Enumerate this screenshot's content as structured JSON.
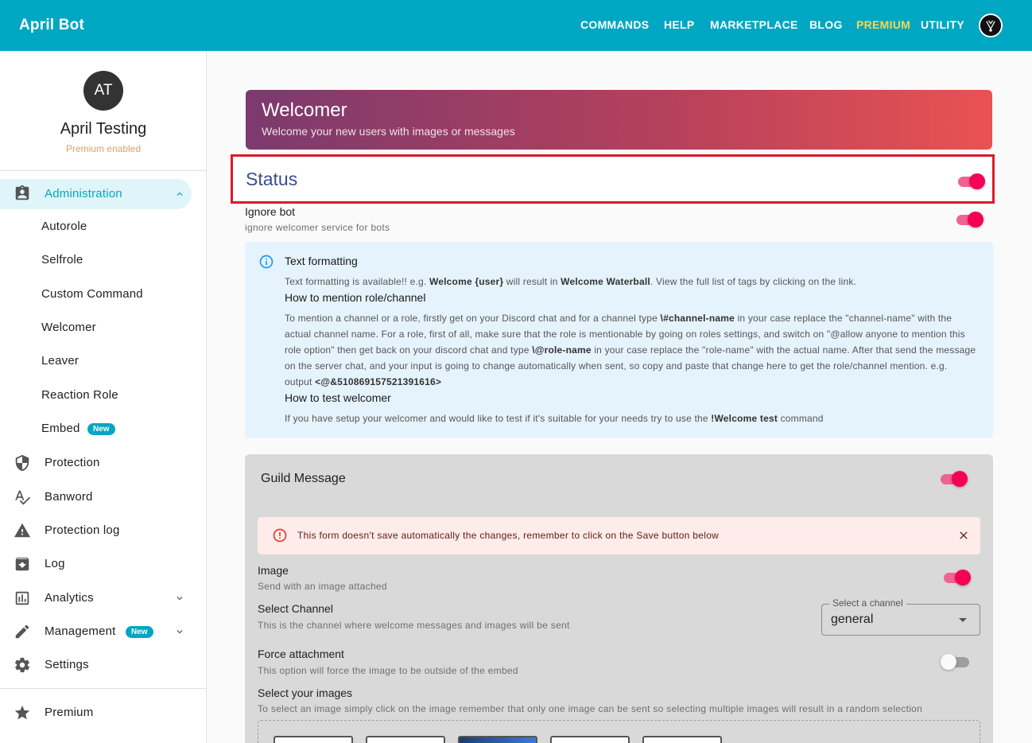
{
  "app": {
    "brand": "April Bot"
  },
  "topnav": {
    "items": [
      "COMMANDS",
      "HELP",
      "MARKETPLACE",
      "BLOG",
      "PREMIUM",
      "UTILITY"
    ]
  },
  "user": {
    "initials": "AT",
    "name": "April Testing",
    "subtitle": "Premium enabled"
  },
  "sidebar": {
    "administration": "Administration",
    "sub_items": [
      "Autorole",
      "Selfrole",
      "Custom Command",
      "Welcomer",
      "Leaver",
      "Reaction Role",
      "Embed"
    ],
    "embed_badge": "New",
    "items": [
      {
        "label": "Protection",
        "icon": "shield-icon"
      },
      {
        "label": "Banword",
        "icon": "spellcheck-icon"
      },
      {
        "label": "Protection log",
        "icon": "warning-icon"
      },
      {
        "label": "Log",
        "icon": "archive-icon"
      },
      {
        "label": "Analytics",
        "icon": "chart-icon"
      },
      {
        "label": "Management",
        "icon": "pencil-icon"
      },
      {
        "label": "Settings",
        "icon": "gear-icon"
      }
    ],
    "management_badge": "New",
    "premium": "Premium"
  },
  "banner": {
    "title": "Welcomer",
    "subtitle": "Welcome your new users with images or messages"
  },
  "status": {
    "title": "Status",
    "enabled": true
  },
  "ignore_bot": {
    "label": "Ignore bot",
    "description": "ignore welcomer service for bots",
    "enabled": true
  },
  "info": {
    "h1": "Text formatting",
    "p1_a": "Text formatting is available!! e.g. ",
    "p1_b": "Welcome {user}",
    "p1_c": " will result in ",
    "p1_d": "Welcome Waterball",
    "p1_e": ". View the full list of tags by clicking on the link.",
    "h2": "How to mention role/channel",
    "p2_a": "To mention a channel or a role, firstly get on your Discord chat and for a channel type ",
    "p2_b": "\\#channel-name",
    "p2_c": " in your case replace the \"channel-name\" with the actual channel name. For a role, first of all, make sure that the role is mentionable by going on roles settings, and switch on \"@allow anyone to mention this role option\" then get back on your discord chat and type ",
    "p2_d": "\\@role-name",
    "p2_e": " in your case replace the \"role-name\" with the actual name. After that send the message on the server chat, and your input is going to change automatically when sent, so copy and paste that change here to get the role/channel mention. e.g. output ",
    "p2_f": "<@&510869157521391616>",
    "h3": "How to test welcomer",
    "p3_a": "If you have setup your welcomer and would like to test if it's suitable for your needs try to use the ",
    "p3_b": "!Welcome test",
    "p3_c": " command"
  },
  "guild": {
    "title": "Guild Message",
    "enabled": true,
    "alert": "This form doesn't save automatically the changes, remember to click on the Save button below",
    "image_label": "Image",
    "image_desc": "Send with an image attached",
    "image_enabled": true,
    "channel_label": "Select Channel",
    "channel_desc": "This is the channel where welcome messages and images will be sent",
    "channel_legend": "Select a channel",
    "channel_value": "general",
    "force_label": "Force attachment",
    "force_desc": "This option will force the image to be outside of the embed",
    "force_enabled": false,
    "images_label": "Select your images",
    "images_desc": "To select an image simply click on the image remember that only one image can be sent so selecting multiple images will result in a random selection"
  },
  "colors": {
    "accent": "#00a7c2",
    "toggle_on": "#f50057",
    "status_border": "#d81b29",
    "premium": "#ffd54f"
  }
}
